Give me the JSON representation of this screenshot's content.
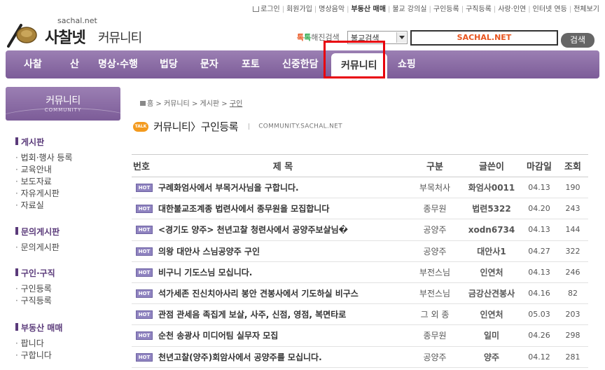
{
  "top_links": [
    {
      "label": "로그인",
      "bold": false
    },
    {
      "label": "회원가입",
      "bold": false
    },
    {
      "label": "명상음악",
      "bold": false
    },
    {
      "label": "부동산 매매",
      "bold": true
    },
    {
      "label": "불교 강의실",
      "bold": false
    },
    {
      "label": "구인등록",
      "bold": false
    },
    {
      "label": "구직등록",
      "bold": false
    },
    {
      "label": "사랑·인연",
      "bold": false
    },
    {
      "label": "인터넷 연등",
      "bold": false
    },
    {
      "label": "전체보기",
      "bold": false
    }
  ],
  "logo": {
    "url_text": "sachal.net",
    "site_name": "사찰넷",
    "section": "커뮤니티"
  },
  "search": {
    "label_part1": "톡",
    "label_part2": "톡",
    "label_rest": "해진검색",
    "select_value": "불교검색",
    "input_value": "SACHAL.NET",
    "button_label": "검색"
  },
  "nav": [
    {
      "label": "사찰"
    },
    {
      "label": "산"
    },
    {
      "label": "명상·수행"
    },
    {
      "label": "법당"
    },
    {
      "label": "문자"
    },
    {
      "label": "포토"
    },
    {
      "label": "신중한담"
    },
    {
      "label": "커뮤니티"
    },
    {
      "label": "쇼핑"
    }
  ],
  "sidebar": {
    "title": "커뮤니티",
    "subtitle": "COMMUNITY",
    "groups": [
      {
        "title": "게시판",
        "items": [
          "법회·행사 등록",
          "교육안내",
          "보도자료",
          "자유게시판",
          "자료실"
        ]
      },
      {
        "title": "문의게시판",
        "items": [
          "문의게시판"
        ]
      },
      {
        "title": "구인·구직",
        "items": [
          "구인등록",
          "구직등록"
        ]
      },
      {
        "title": "부동산 매매",
        "items": [
          "팝니다",
          "구합니다"
        ]
      }
    ]
  },
  "breadcrumb": {
    "home": "홈",
    "path": [
      "커뮤니티",
      "게시판",
      "구인"
    ]
  },
  "page_title": {
    "badge": "TALK",
    "title": "커뮤니티〉구인등록",
    "subtitle": "COMMUNITY.SACHAL.NET"
  },
  "table": {
    "headers": {
      "no": "번호",
      "subject": "제 목",
      "category": "구분",
      "author": "글쓴이",
      "deadline": "마감일",
      "views": "조회"
    },
    "badge": "HOT",
    "rows": [
      {
        "subject": "구례화엄사에서 부목거사님을 구합니다.",
        "category": "부목처사",
        "author": "화엄사0011",
        "deadline": "04.13",
        "views": "190"
      },
      {
        "subject": "대한불교조계종 법련사에서 종무원을 모집합니다",
        "category": "종무원",
        "author": "법련5322",
        "deadline": "04.20",
        "views": "243"
      },
      {
        "subject": "<경기도 양주> 천년고찰 청련사에서 공양주보살님�",
        "category": "공양주",
        "author": "xodn6734",
        "deadline": "04.13",
        "views": "144"
      },
      {
        "subject": "의왕 대안사 스님공양주 구인",
        "category": "공양주",
        "author": "대안사1",
        "deadline": "04.27",
        "views": "322"
      },
      {
        "subject": "비구니 기도스님 모십니다.",
        "category": "부전스님",
        "author": "인연처",
        "deadline": "04.13",
        "views": "246"
      },
      {
        "subject": "석가세존 진신치아사리 봉안 견봉사에서 기도하실 비구스",
        "category": "부전스님",
        "author": "금강산견봉사",
        "deadline": "04.16",
        "views": "82"
      },
      {
        "subject": "관점 관세음 족집게 보살, 사주, 신점, 영점, 복면타로",
        "category": "그 외 종",
        "author": "인연처",
        "deadline": "05.03",
        "views": "203"
      },
      {
        "subject": "순천 송광사 미디어팀 실무자 모집",
        "category": "종무원",
        "author": "일미",
        "deadline": "04.26",
        "views": "298"
      },
      {
        "subject": "천년고찰(양주)회암사에서 공양주를 모십니다.",
        "category": "공양주",
        "author": "양주",
        "deadline": "04.12",
        "views": "281"
      }
    ]
  },
  "colors": {
    "nav_purple": "#8a6aa6",
    "highlight_red": "#e8000b",
    "hot_badge": "#8f83c0",
    "search_accent": "#e8541e"
  }
}
